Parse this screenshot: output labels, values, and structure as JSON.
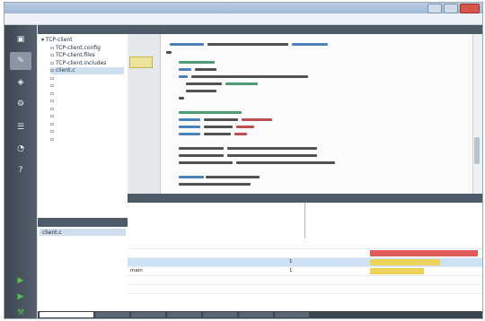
{
  "window": {
    "title": ""
  },
  "menu": {
    "items": [
      "",
      "",
      "",
      "",
      "",
      "",
      "",
      "",
      ""
    ]
  },
  "modes": [
    {
      "icon": "welcome-icon",
      "label": ""
    },
    {
      "icon": "edit-icon",
      "label": ""
    },
    {
      "icon": "design-icon",
      "label": ""
    },
    {
      "icon": "debug-icon",
      "label": ""
    },
    {
      "icon": "projects-icon",
      "label": ""
    },
    {
      "icon": "analyze-icon",
      "label": ""
    },
    {
      "icon": "help-icon",
      "label": ""
    }
  ],
  "project_tree": {
    "items": [
      {
        "label": "TCP-client",
        "indent": 0
      },
      {
        "label": "TCP-client.config",
        "indent": 1
      },
      {
        "label": "TCP-client.files",
        "indent": 1
      },
      {
        "label": "TCP-client.includes",
        "indent": 1
      },
      {
        "label": "client.c",
        "indent": 1
      },
      {
        "label": "",
        "indent": 1
      },
      {
        "label": "",
        "indent": 1
      },
      {
        "label": "",
        "indent": 1
      },
      {
        "label": "",
        "indent": 1
      },
      {
        "label": "",
        "indent": 1
      },
      {
        "label": "",
        "indent": 1
      },
      {
        "label": "",
        "indent": 1
      },
      {
        "label": "",
        "indent": 1
      },
      {
        "label": "",
        "indent": 1
      }
    ]
  },
  "open_documents": {
    "selected": "client.c"
  },
  "editor": {
    "marker_label": ""
  },
  "profiler": {
    "top_columns_left": [
      "",
      "",
      ""
    ],
    "top_columns_right": [
      "",
      "",
      ""
    ],
    "table_headers": [
      "",
      "",
      "",
      "",
      "",
      ""
    ],
    "rows": [
      {
        "name": "",
        "location": "",
        "calls": "",
        "self": "",
        "cost_pct": 1.0,
        "cost_color": "#e05a5a",
        "total": ""
      },
      {
        "name": "",
        "location": "",
        "calls": "1",
        "self": "",
        "cost_pct": 0.65,
        "cost_color": "#eed35a",
        "total": ""
      },
      {
        "name": "main",
        "location": "",
        "calls": "1",
        "self": "",
        "cost_pct": 0.5,
        "cost_color": "#eed35a",
        "total": ""
      },
      {
        "name": "",
        "location": "",
        "calls": "",
        "self": "",
        "cost_pct": 0.0,
        "cost_color": "#ffffff",
        "total": ""
      },
      {
        "name": "",
        "location": "",
        "calls": "",
        "self": "",
        "cost_pct": 0.0,
        "cost_color": "#ffffff",
        "total": ""
      },
      {
        "name": "",
        "location": "",
        "calls": "",
        "self": "",
        "cost_pct": 0.0,
        "cost_color": "#ffffff",
        "total": ""
      }
    ]
  },
  "colors": {
    "accent": "#4d5a68",
    "highlight": "#e05a5a",
    "warn": "#eed35a"
  }
}
